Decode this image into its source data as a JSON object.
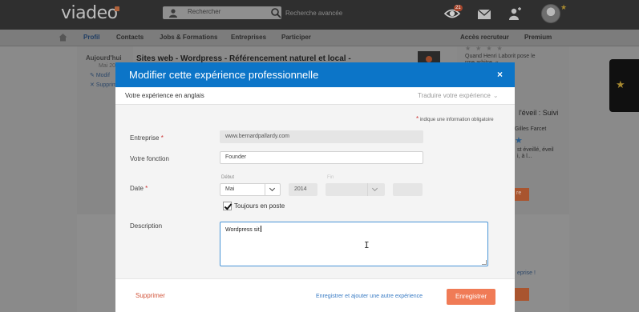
{
  "header": {
    "logo": "viadeo",
    "search_placeholder": "Rechercher",
    "advanced_search": "Recherche avancée",
    "notifications_count": "21"
  },
  "nav": {
    "items": [
      "Profil",
      "Contacts",
      "Jobs & Formations",
      "Entreprises",
      "Participer"
    ],
    "right_items": [
      "Accès recruteur",
      "Premium"
    ]
  },
  "background": {
    "today": "Aujourd'hui",
    "date": "Mai 201",
    "modify": "Modif",
    "delete": "Supprim",
    "exp_title": "Sites web - Wordpress - Référencement naturel et local -",
    "r_quote1": "Quand Henri Laborit pose le",
    "r_quote2": "rme arbitre. «...",
    "r_eveil": "l'éveil : Suivi",
    "r_gilles": "Gilles Farcet",
    "r_t1": "st éveillé, éveil",
    "r_t2": "i, à l...",
    "r_btn": "re",
    "r_entr": "eprise !"
  },
  "modal": {
    "title": "Modifier cette expérience professionnelle",
    "close": "×",
    "tab_active": "Votre expérience en anglais",
    "tab_translate": "Traduire votre expérience",
    "required_note": "indique une information obligatoire",
    "labels": {
      "company": "Entreprise",
      "position": "Votre fonction",
      "date": "Date",
      "description": "Description"
    },
    "company_value": "www.bernardpallardy.com",
    "position_value": "Founder",
    "start_label": "Début",
    "end_label": "Fin",
    "start_month": "Mai",
    "start_year": "2014",
    "end_month": "",
    "end_year": "",
    "current_label": "Toujours en poste",
    "current_checked": true,
    "description_value": "Wordpress sit",
    "footer": {
      "delete": "Supprimer",
      "save_add": "Enregistrer et ajouter une autre expérience",
      "save": "Enregistrer"
    }
  },
  "colors": {
    "modal_header": "#0c75c8",
    "save_button": "#f07b56",
    "delete_link": "#d2553b"
  }
}
